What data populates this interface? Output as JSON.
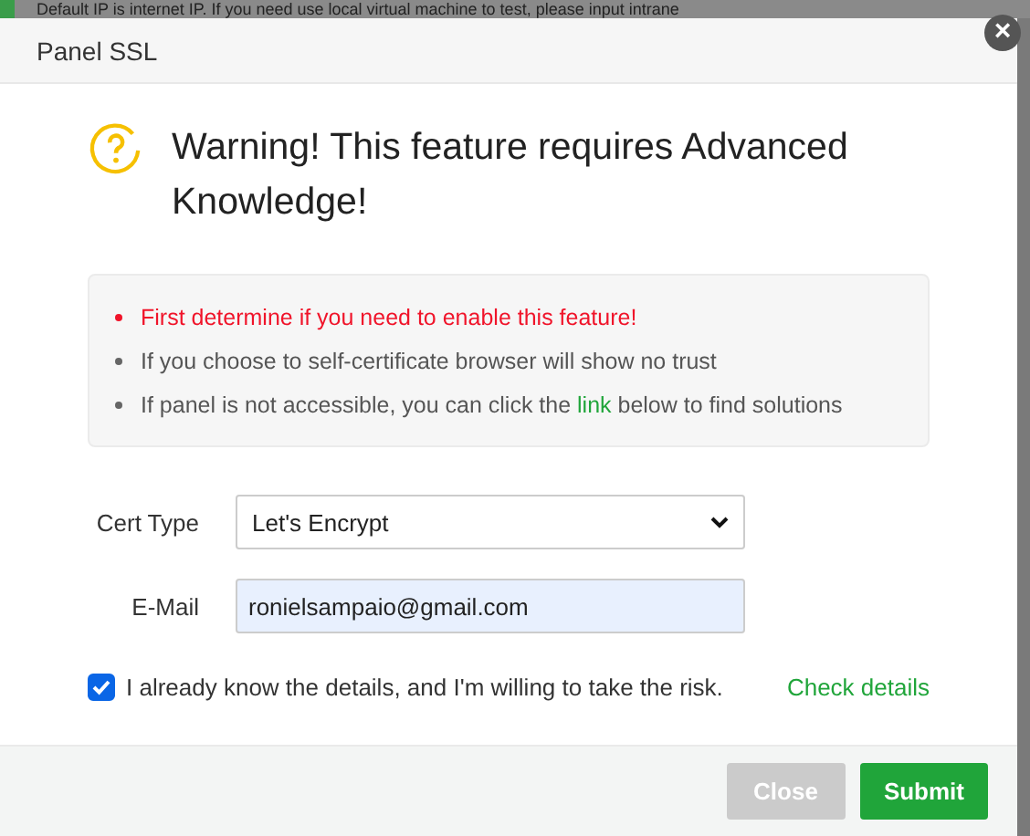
{
  "backdrop": {
    "text": "Default IP is internet IP. If you need use local virtual machine to test, please input intrane"
  },
  "dialog": {
    "title": "Panel SSL",
    "close_icon": "×"
  },
  "warning": {
    "heading": "Warning! This feature requires Advanced Knowledge!"
  },
  "notes": [
    {
      "kind": "alert",
      "parts": [
        {
          "text": "First determine if you need to enable this feature!"
        }
      ]
    },
    {
      "kind": "info",
      "parts": [
        {
          "text": "If you choose to self-certificate browser will show no trust"
        }
      ]
    },
    {
      "kind": "info",
      "parts": [
        {
          "text": "If panel is not accessible, you can click the "
        },
        {
          "text": "link",
          "kind": "link"
        },
        {
          "text": " below to find solutions"
        }
      ]
    }
  ],
  "form": {
    "fields": [
      {
        "label": "Cert Type",
        "kind": "select",
        "value": "Let's Encrypt"
      },
      {
        "label": "E-Mail",
        "kind": "input",
        "value": "ronielsampaio@gmail.com"
      }
    ]
  },
  "agreement": {
    "label": "I already know the details, and I'm willing to take the risk.",
    "checked": true,
    "link": "Check details"
  },
  "buttons": [
    {
      "label": "Close",
      "kind": "secondary"
    },
    {
      "label": "Submit",
      "kind": "primary"
    }
  ]
}
